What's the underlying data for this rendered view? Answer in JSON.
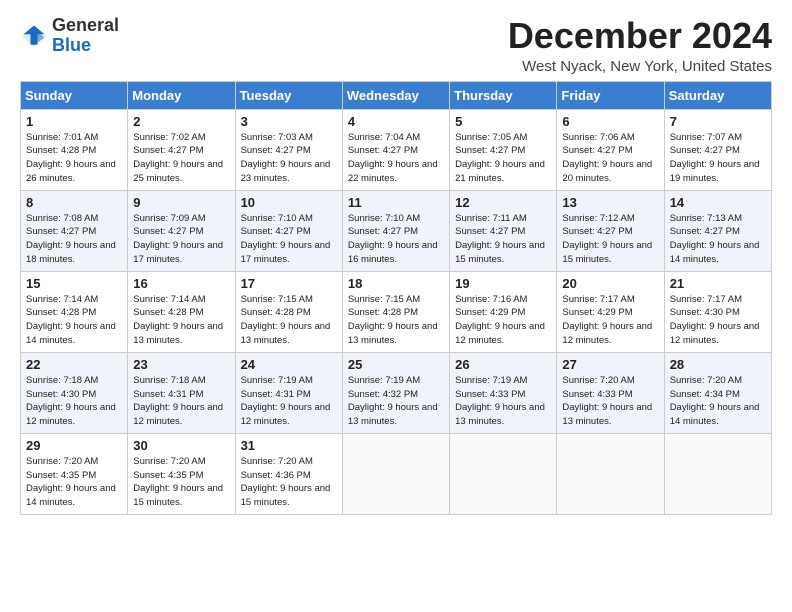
{
  "header": {
    "logo_general": "General",
    "logo_blue": "Blue",
    "title": "December 2024",
    "location": "West Nyack, New York, United States"
  },
  "weekdays": [
    "Sunday",
    "Monday",
    "Tuesday",
    "Wednesday",
    "Thursday",
    "Friday",
    "Saturday"
  ],
  "weeks": [
    [
      {
        "day": "1",
        "sunrise": "Sunrise: 7:01 AM",
        "sunset": "Sunset: 4:28 PM",
        "daylight": "Daylight: 9 hours and 26 minutes."
      },
      {
        "day": "2",
        "sunrise": "Sunrise: 7:02 AM",
        "sunset": "Sunset: 4:27 PM",
        "daylight": "Daylight: 9 hours and 25 minutes."
      },
      {
        "day": "3",
        "sunrise": "Sunrise: 7:03 AM",
        "sunset": "Sunset: 4:27 PM",
        "daylight": "Daylight: 9 hours and 23 minutes."
      },
      {
        "day": "4",
        "sunrise": "Sunrise: 7:04 AM",
        "sunset": "Sunset: 4:27 PM",
        "daylight": "Daylight: 9 hours and 22 minutes."
      },
      {
        "day": "5",
        "sunrise": "Sunrise: 7:05 AM",
        "sunset": "Sunset: 4:27 PM",
        "daylight": "Daylight: 9 hours and 21 minutes."
      },
      {
        "day": "6",
        "sunrise": "Sunrise: 7:06 AM",
        "sunset": "Sunset: 4:27 PM",
        "daylight": "Daylight: 9 hours and 20 minutes."
      },
      {
        "day": "7",
        "sunrise": "Sunrise: 7:07 AM",
        "sunset": "Sunset: 4:27 PM",
        "daylight": "Daylight: 9 hours and 19 minutes."
      }
    ],
    [
      {
        "day": "8",
        "sunrise": "Sunrise: 7:08 AM",
        "sunset": "Sunset: 4:27 PM",
        "daylight": "Daylight: 9 hours and 18 minutes."
      },
      {
        "day": "9",
        "sunrise": "Sunrise: 7:09 AM",
        "sunset": "Sunset: 4:27 PM",
        "daylight": "Daylight: 9 hours and 17 minutes."
      },
      {
        "day": "10",
        "sunrise": "Sunrise: 7:10 AM",
        "sunset": "Sunset: 4:27 PM",
        "daylight": "Daylight: 9 hours and 17 minutes."
      },
      {
        "day": "11",
        "sunrise": "Sunrise: 7:10 AM",
        "sunset": "Sunset: 4:27 PM",
        "daylight": "Daylight: 9 hours and 16 minutes."
      },
      {
        "day": "12",
        "sunrise": "Sunrise: 7:11 AM",
        "sunset": "Sunset: 4:27 PM",
        "daylight": "Daylight: 9 hours and 15 minutes."
      },
      {
        "day": "13",
        "sunrise": "Sunrise: 7:12 AM",
        "sunset": "Sunset: 4:27 PM",
        "daylight": "Daylight: 9 hours and 15 minutes."
      },
      {
        "day": "14",
        "sunrise": "Sunrise: 7:13 AM",
        "sunset": "Sunset: 4:27 PM",
        "daylight": "Daylight: 9 hours and 14 minutes."
      }
    ],
    [
      {
        "day": "15",
        "sunrise": "Sunrise: 7:14 AM",
        "sunset": "Sunset: 4:28 PM",
        "daylight": "Daylight: 9 hours and 14 minutes."
      },
      {
        "day": "16",
        "sunrise": "Sunrise: 7:14 AM",
        "sunset": "Sunset: 4:28 PM",
        "daylight": "Daylight: 9 hours and 13 minutes."
      },
      {
        "day": "17",
        "sunrise": "Sunrise: 7:15 AM",
        "sunset": "Sunset: 4:28 PM",
        "daylight": "Daylight: 9 hours and 13 minutes."
      },
      {
        "day": "18",
        "sunrise": "Sunrise: 7:15 AM",
        "sunset": "Sunset: 4:28 PM",
        "daylight": "Daylight: 9 hours and 13 minutes."
      },
      {
        "day": "19",
        "sunrise": "Sunrise: 7:16 AM",
        "sunset": "Sunset: 4:29 PM",
        "daylight": "Daylight: 9 hours and 12 minutes."
      },
      {
        "day": "20",
        "sunrise": "Sunrise: 7:17 AM",
        "sunset": "Sunset: 4:29 PM",
        "daylight": "Daylight: 9 hours and 12 minutes."
      },
      {
        "day": "21",
        "sunrise": "Sunrise: 7:17 AM",
        "sunset": "Sunset: 4:30 PM",
        "daylight": "Daylight: 9 hours and 12 minutes."
      }
    ],
    [
      {
        "day": "22",
        "sunrise": "Sunrise: 7:18 AM",
        "sunset": "Sunset: 4:30 PM",
        "daylight": "Daylight: 9 hours and 12 minutes."
      },
      {
        "day": "23",
        "sunrise": "Sunrise: 7:18 AM",
        "sunset": "Sunset: 4:31 PM",
        "daylight": "Daylight: 9 hours and 12 minutes."
      },
      {
        "day": "24",
        "sunrise": "Sunrise: 7:19 AM",
        "sunset": "Sunset: 4:31 PM",
        "daylight": "Daylight: 9 hours and 12 minutes."
      },
      {
        "day": "25",
        "sunrise": "Sunrise: 7:19 AM",
        "sunset": "Sunset: 4:32 PM",
        "daylight": "Daylight: 9 hours and 13 minutes."
      },
      {
        "day": "26",
        "sunrise": "Sunrise: 7:19 AM",
        "sunset": "Sunset: 4:33 PM",
        "daylight": "Daylight: 9 hours and 13 minutes."
      },
      {
        "day": "27",
        "sunrise": "Sunrise: 7:20 AM",
        "sunset": "Sunset: 4:33 PM",
        "daylight": "Daylight: 9 hours and 13 minutes."
      },
      {
        "day": "28",
        "sunrise": "Sunrise: 7:20 AM",
        "sunset": "Sunset: 4:34 PM",
        "daylight": "Daylight: 9 hours and 14 minutes."
      }
    ],
    [
      {
        "day": "29",
        "sunrise": "Sunrise: 7:20 AM",
        "sunset": "Sunset: 4:35 PM",
        "daylight": "Daylight: 9 hours and 14 minutes."
      },
      {
        "day": "30",
        "sunrise": "Sunrise: 7:20 AM",
        "sunset": "Sunset: 4:35 PM",
        "daylight": "Daylight: 9 hours and 15 minutes."
      },
      {
        "day": "31",
        "sunrise": "Sunrise: 7:20 AM",
        "sunset": "Sunset: 4:36 PM",
        "daylight": "Daylight: 9 hours and 15 minutes."
      },
      null,
      null,
      null,
      null
    ]
  ]
}
